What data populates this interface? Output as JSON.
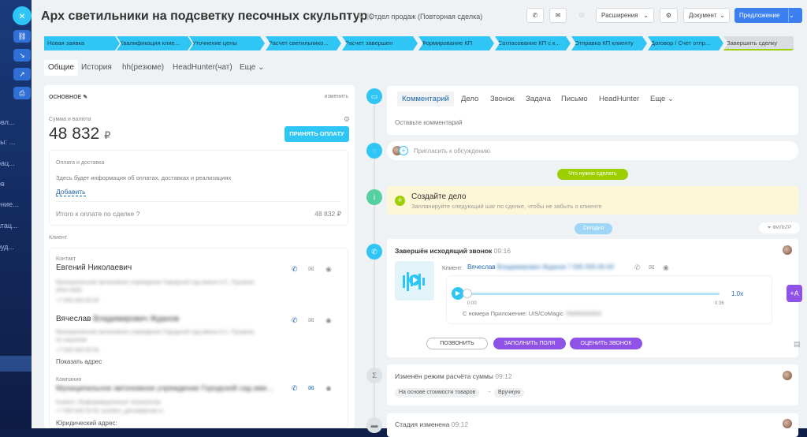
{
  "sidebar": {
    "items": [
      "овл...",
      "ты: ...",
      "рац...",
      "ов",
      "ение...",
      "атац...",
      "руд..."
    ],
    "close": "×"
  },
  "header": {
    "title": "Арх светильники на подсветку песочных скульптур",
    "department": "Отдел продаж (Повторная сделка)",
    "extensions": "Расширения",
    "document": "Документ",
    "proposal": "Предложение"
  },
  "stages": [
    "Новая заявка",
    "Квалификация клие...",
    "Уточнение цены",
    "Расчет светильнико...",
    "Расчет завершен",
    "Формирование КП",
    "Согласование КП с к...",
    "Отправка КП клиенту",
    "Договор / Счет отпр...",
    "Завершить сделку"
  ],
  "tabs": [
    "Общие",
    "История",
    "hh(резюме)",
    "HeadHunter(чат)",
    "Еще"
  ],
  "left": {
    "section_title": "ОСНОВНОЕ",
    "edit_link": "изменить",
    "sum_label": "Сумма и валюта",
    "sum_value": "48 832",
    "currency": "₽",
    "accept_payment": "ПРИНЯТЬ ОПЛАТУ",
    "payment": {
      "title": "Оплата и доставка",
      "info": "Здесь будет информация об оплатах, доставках и реализациях",
      "add": "Добавить",
      "total_label": "Итого к оплате по сделке",
      "total_value": "48 832 ₽"
    },
    "client_label": "Клиент",
    "contact1": {
      "label": "Контакт",
      "name": "Евгений Николаевич",
      "org": "Муниципальное автономное учреждение Городской сад имени А.С. Пушкина",
      "sub": "ИНН 0000",
      "phone": "+7 000 000 00 00"
    },
    "contact2": {
      "name": "Вячеслав",
      "name_blur": "Владимирович Жданов",
      "org": "Муниципальное автономное учреждение Городской сад имени А.С. Пушкина",
      "sub": "по закупкам",
      "phone": "+7 000 000 00 00",
      "show_address": "Показать адрес"
    },
    "company": {
      "label": "Компания",
      "name": "Муниципальное автономное учреждение Городской сад име...",
      "type": "Клиент, Информационные технологии",
      "contacts": "+7 000 000 00 00, pushkin_gorsad@mail.ru",
      "legal": "Юридический адрес:"
    }
  },
  "right": {
    "comm_tabs": [
      "Комментарий",
      "Дело",
      "Звонок",
      "Задача",
      "Письмо",
      "HeadHunter",
      "Еще"
    ],
    "comment_placeholder": "Оставьте комментарий",
    "invite": "Пригласить к обсуждению",
    "todo_pill": "Что нужно сделать",
    "create_title": "Создайте дело",
    "create_hint": "Запланируйте следующий шаг по сделке, чтобы не забыть о клиенте",
    "today_pill": "Сегодня",
    "filter": "ФИЛЬТР",
    "call": {
      "title": "Завершён исходящий звонок",
      "time": "09:16",
      "client_label": "Клиент",
      "client_name": "Вячеслав",
      "client_blur": "Владимирович Жданов 7 000 000-00-00",
      "start": "0:00",
      "end": "0:36",
      "speed": "1.0x",
      "ai": "+A",
      "from": "С номера Приложение: UIS/CoMagic",
      "from_blur": "79000000000",
      "call_btn": "ПОЗВОНИТЬ",
      "fill_btn": "ЗАПОЛНИТЬ ПОЛЯ",
      "rate_btn": "ОЦЕНИТЬ ЗВОНОК",
      "playback_progress": 0.0
    },
    "change": {
      "title": "Изменён режим расчёта суммы",
      "time": "09:12",
      "from": "На основе стоимости товаров",
      "arrow": "→",
      "to": "Вручную"
    },
    "stage_change": {
      "title": "Стадия изменена",
      "time": "09:12"
    }
  },
  "colors": {
    "accent": "#2fc6f6",
    "primary": "#3b7ff0",
    "green": "#9dcf00",
    "purple": "#8f52e6"
  }
}
